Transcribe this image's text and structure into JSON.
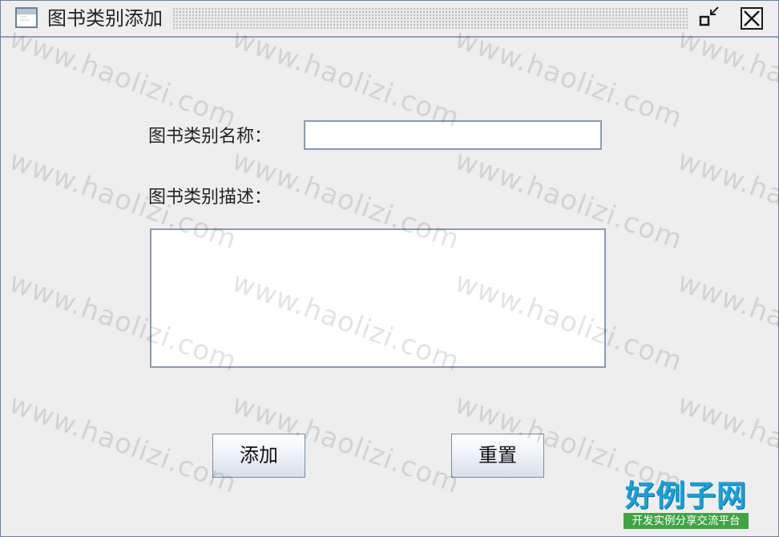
{
  "window": {
    "title": "图书类别添加",
    "icons": {
      "app": "window-icon",
      "minimize": "minimize-icon",
      "close": "close-icon"
    }
  },
  "form": {
    "name_label": "图书类别名称：",
    "name_value": "",
    "desc_label": "图书类别描述：",
    "desc_value": ""
  },
  "buttons": {
    "add_label": "添加",
    "reset_label": "重置"
  },
  "watermark": {
    "text": "www.haolizi.com"
  },
  "logo": {
    "main": "好例子网",
    "sub": "开发实例分享交流平台"
  },
  "colors": {
    "background": "#eeeeee",
    "border": "#8b9bb0",
    "logo_blue": "#1aa0d8",
    "logo_green": "#3fa543"
  }
}
